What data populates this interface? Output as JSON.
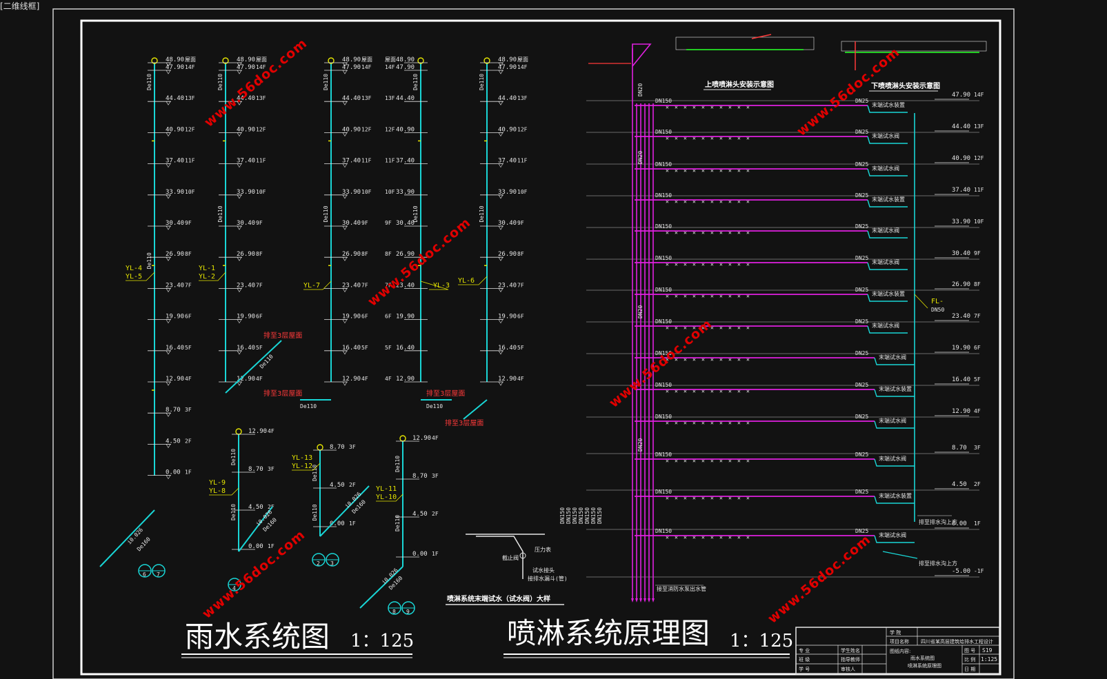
{
  "window_title": "[二维线框]",
  "rain": {
    "title": "雨水系统图",
    "scale": "1：125",
    "levels": [
      {
        "elev": "48.90",
        "floor": "屋面"
      },
      {
        "elev": "47.90",
        "floor": "14F"
      },
      {
        "elev": "44.40",
        "floor": "13F"
      },
      {
        "elev": "40.90",
        "floor": "12F"
      },
      {
        "elev": "37.40",
        "floor": "11F"
      },
      {
        "elev": "33.90",
        "floor": "10F"
      },
      {
        "elev": "30.40",
        "floor": "9F"
      },
      {
        "elev": "26.90",
        "floor": "8F"
      },
      {
        "elev": "23.40",
        "floor": "7F"
      },
      {
        "elev": "19.90",
        "floor": "6F"
      },
      {
        "elev": "16.40",
        "floor": "5F"
      },
      {
        "elev": "12.90",
        "floor": "4F"
      },
      {
        "elev": "8.70",
        "floor": "3F"
      },
      {
        "elev": "4.50",
        "floor": "2F"
      },
      {
        "elev": "0.00",
        "floor": "1F"
      }
    ],
    "pipe_size": "De110",
    "outlet_size": "De160",
    "slope": "i0.026",
    "groups": [
      "YL-4",
      "YL-5",
      "YL-1",
      "YL-2",
      "YL-7",
      "YL-3",
      "YL-6",
      "YL-9",
      "YL-8",
      "YL-13",
      "YL-12",
      "YL-11",
      "YL-10"
    ],
    "drain_note": "排至3层屋面",
    "circles": [
      [
        "6",
        "7"
      ],
      [
        "4"
      ],
      [
        "2",
        "3"
      ],
      [
        "8",
        "9"
      ]
    ]
  },
  "sprinkler": {
    "title": "喷淋系统原理图",
    "scale": "1：125",
    "levels": [
      {
        "elev": "47.90",
        "floor": "14F"
      },
      {
        "elev": "44.40",
        "floor": "13F"
      },
      {
        "elev": "40.90",
        "floor": "12F"
      },
      {
        "elev": "37.40",
        "floor": "11F"
      },
      {
        "elev": "33.90",
        "floor": "10F"
      },
      {
        "elev": "30.40",
        "floor": "9F"
      },
      {
        "elev": "26.90",
        "floor": "8F"
      },
      {
        "elev": "23.40",
        "floor": "7F"
      },
      {
        "elev": "19.90",
        "floor": "6F"
      },
      {
        "elev": "16.40",
        "floor": "5F"
      },
      {
        "elev": "12.90",
        "floor": "4F"
      },
      {
        "elev": "8.70",
        "floor": "3F"
      },
      {
        "elev": "4.50",
        "floor": "2F"
      },
      {
        "elev": "0.00",
        "floor": "1F"
      },
      {
        "elev": "-5.00",
        "floor": "-1F"
      }
    ],
    "main_size": "DN150",
    "branch_size": "DN25",
    "riser_size": "DN20",
    "test_valve_a": "末端试水装置",
    "test_valve_b": "末端试水阀",
    "fl_label": "FL-",
    "fl_size": "DN50",
    "pump_note": "接至消防水泵出水管",
    "drain_note_a": "排至排水沟上方",
    "drain_note_b": "排至排水沟上方",
    "upper_detail": "上喷喷淋头安装示意图",
    "lower_detail": "下喷喷淋头安装示意图",
    "end_detail": "喷淋系统末端试水（试水阀）大样",
    "detail_labels": [
      "压力表",
      "截止阀",
      "试水接头",
      "接排水漏斗(管)"
    ]
  },
  "watermark": "www.56doc.com",
  "title_block": {
    "school": "学  院",
    "project_label": "项目名称",
    "project": "四川省某高层建筑给排水工程设计",
    "drawing_label": "图纸内容:",
    "drawing": "雨水系统图",
    "drawing2": "喷淋系统原理图",
    "major": "专  业",
    "cls": "班  级",
    "sid": "学  号",
    "student": "学生姓名",
    "advisor": "指导教师",
    "reviewer": "审核人",
    "no_label": "图  号",
    "no": "S19",
    "sc_label": "比  例",
    "sc": "1:125",
    "date_label": "日  期"
  }
}
